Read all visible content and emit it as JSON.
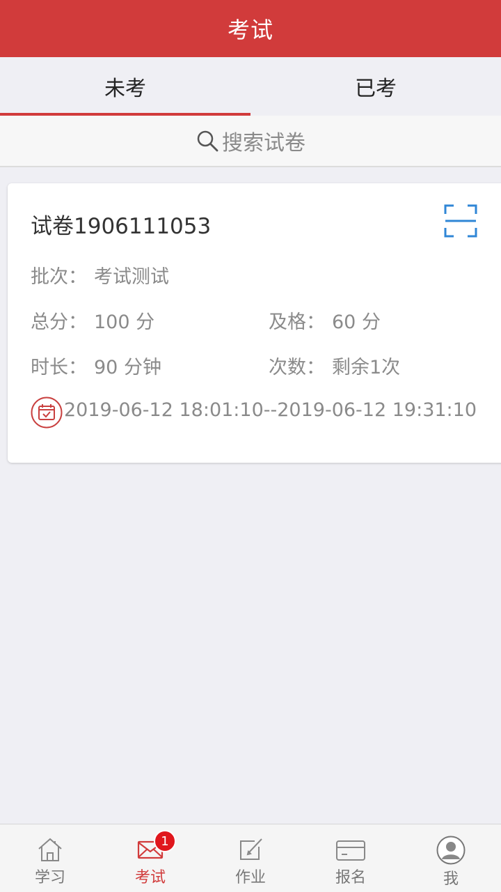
{
  "header": {
    "title": "考试"
  },
  "tabs": [
    {
      "label": "未考",
      "active": true
    },
    {
      "label": "已考",
      "active": false
    }
  ],
  "search": {
    "placeholder": "搜索试卷",
    "icon": "search-icon"
  },
  "exam_card": {
    "title": "试卷1906111053",
    "batch_label": "批次：",
    "batch_value": "考试测试",
    "total_label": "总分：",
    "total_value": "100 分",
    "pass_label": "及格：",
    "pass_value": "60 分",
    "duration_label": "时长：",
    "duration_value": "90 分钟",
    "attempts_label": "次数：",
    "attempts_value": "剩余1次",
    "time_range": "2019-06-12 18:01:10--2019-06-12 19:31:10"
  },
  "bottom_nav": {
    "items": [
      {
        "label": "学习",
        "icon": "home-icon"
      },
      {
        "label": "考试",
        "icon": "mail-icon",
        "badge": "1"
      },
      {
        "label": "作业",
        "icon": "edit-icon"
      },
      {
        "label": "报名",
        "icon": "card-icon"
      },
      {
        "label": "我",
        "icon": "user-icon"
      }
    ]
  },
  "colors": {
    "accent": "#d13b3b",
    "scan_icon": "#2f86d6",
    "badge": "#e0161c"
  }
}
